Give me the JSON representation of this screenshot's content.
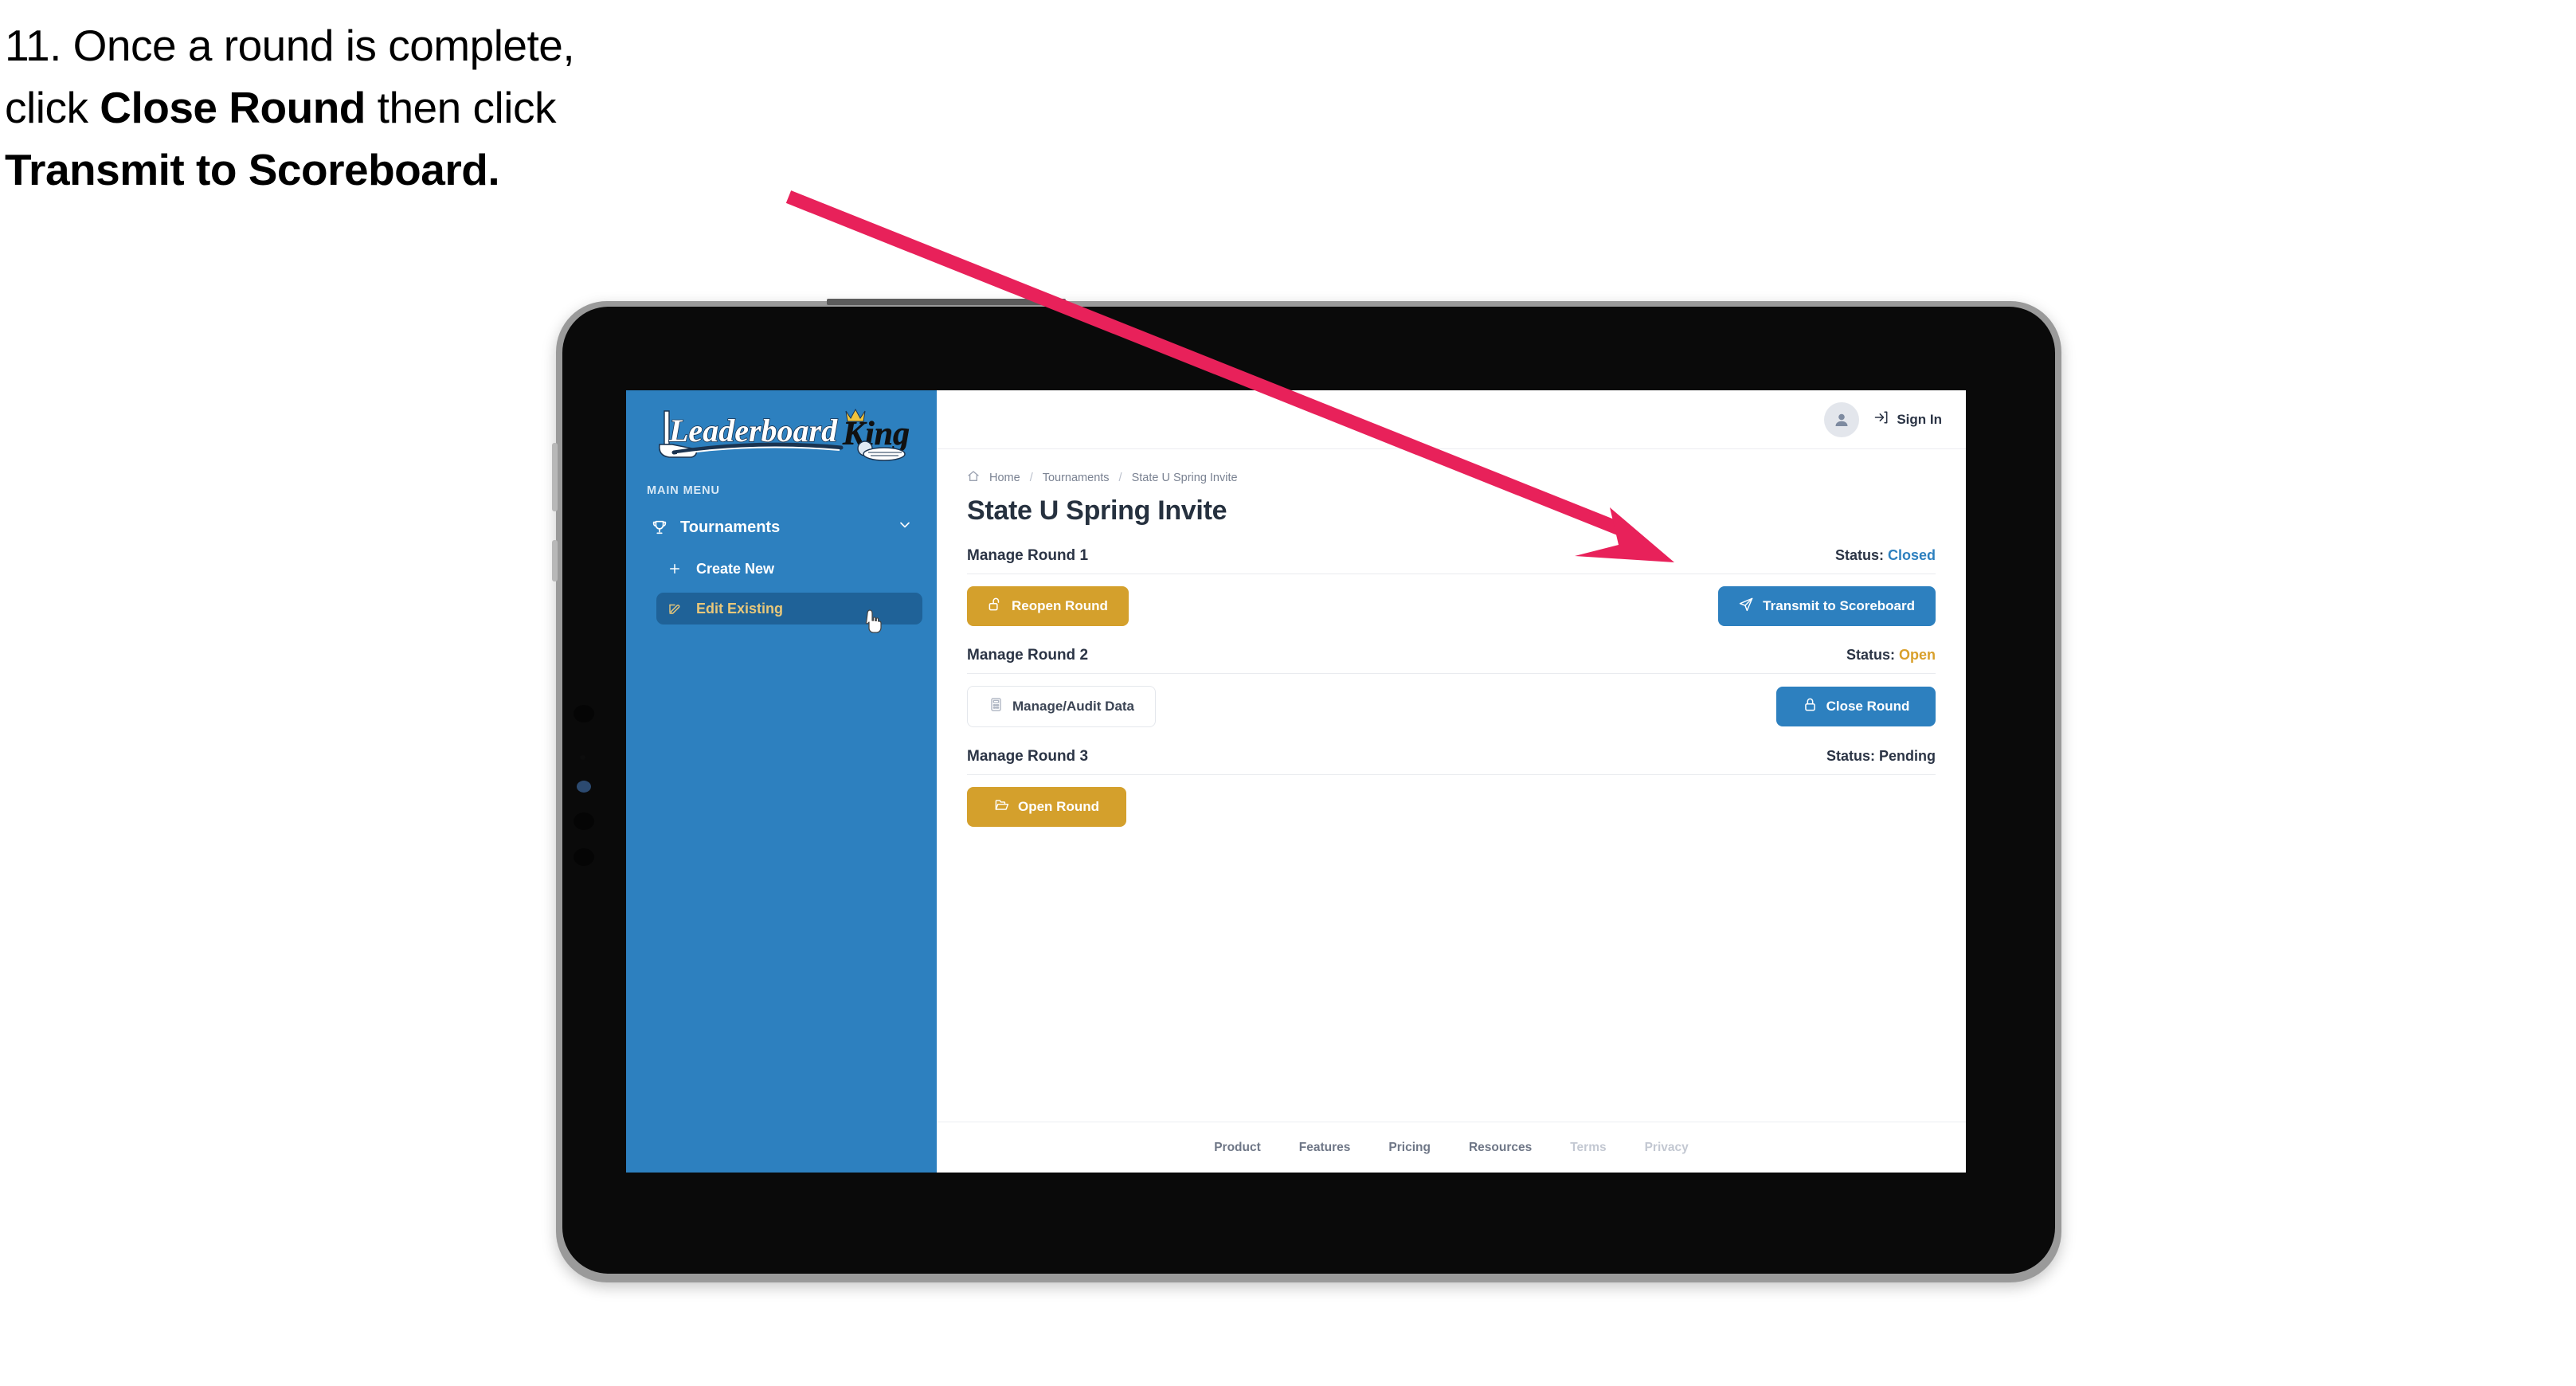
{
  "caption": {
    "line1_prefix": "11. Once a round is complete,",
    "line2_prefix": "click ",
    "line2_bold": "Close Round",
    "line2_suffix": " then click",
    "line3_bold": "Transmit to Scoreboard."
  },
  "annotation": {
    "arrow_color": "#E8215A",
    "arrow_name": "pointer-arrow"
  },
  "app": {
    "logo_word_one": "Leaderboard",
    "logo_word_two": "King",
    "sidebar_color": "#2D80BF",
    "accent_gold": "#D4A02C",
    "accent_blue": "#2D80BF"
  },
  "sidebar": {
    "section_label": "MAIN MENU",
    "items": [
      {
        "label": "Tournaments",
        "icon": "trophy-icon",
        "expanded": true,
        "chevron": "chevron-down-icon"
      },
      {
        "label": "Create New",
        "icon": "plus-icon",
        "active": false
      },
      {
        "label": "Edit Existing",
        "icon": "edit-square-icon",
        "active": true
      }
    ]
  },
  "topbar": {
    "avatar_icon": "user-avatar-icon",
    "signin_icon": "sign-in-icon",
    "signin_label": "Sign In"
  },
  "breadcrumb": {
    "home_icon": "home-icon",
    "items": [
      "Home",
      "Tournaments",
      "State U Spring Invite"
    ],
    "separator": "/"
  },
  "page": {
    "title": "State U Spring Invite"
  },
  "rounds": [
    {
      "name": "Manage Round 1",
      "status_label": "Status:",
      "status_value": "Closed",
      "status_class": "closed",
      "left_button": {
        "label": "Reopen Round",
        "icon": "unlock-icon",
        "style": "gold"
      },
      "right_button": {
        "label": "Transmit to Scoreboard",
        "icon": "paper-plane-icon",
        "style": "blue"
      }
    },
    {
      "name": "Manage Round 2",
      "status_label": "Status:",
      "status_value": "Open",
      "status_class": "open",
      "left_button": {
        "label": "Manage/Audit Data",
        "icon": "calculator-icon",
        "style": "ghost"
      },
      "right_button": {
        "label": "Close Round",
        "icon": "lock-icon",
        "style": "blue"
      }
    },
    {
      "name": "Manage Round 3",
      "status_label": "Status:",
      "status_value": "Pending",
      "status_class": "pending",
      "left_button": {
        "label": "Open Round",
        "icon": "open-folder-icon",
        "style": "gold"
      },
      "right_button": null
    }
  ],
  "footer": {
    "links": [
      {
        "label": "Product",
        "muted": false
      },
      {
        "label": "Features",
        "muted": false
      },
      {
        "label": "Pricing",
        "muted": false
      },
      {
        "label": "Resources",
        "muted": false
      },
      {
        "label": "Terms",
        "muted": true
      },
      {
        "label": "Privacy",
        "muted": true
      }
    ]
  }
}
